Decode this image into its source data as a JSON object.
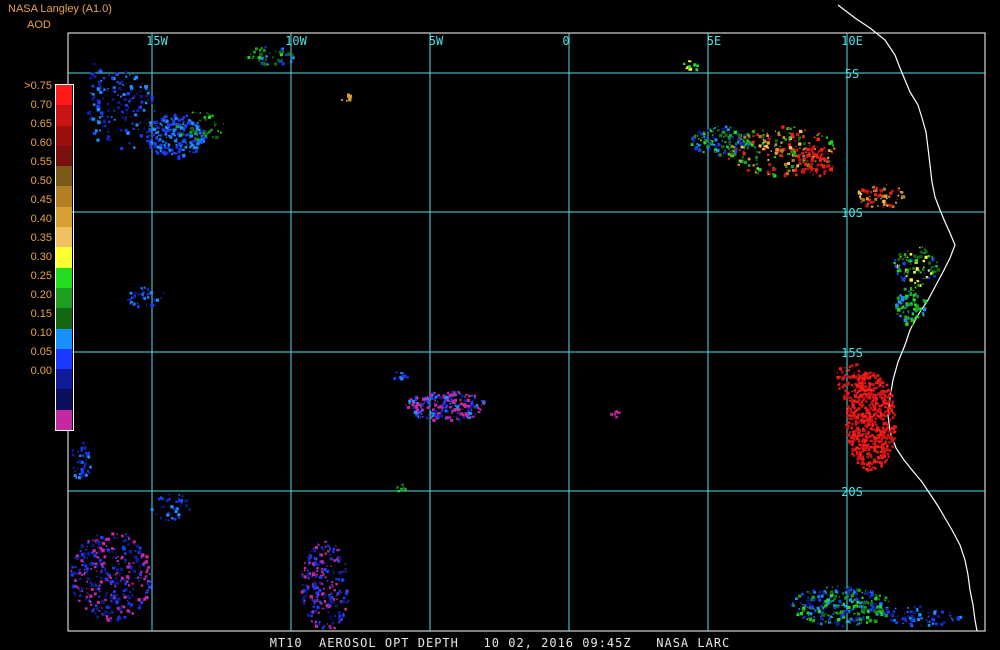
{
  "header": {
    "source": "NASA Langley (A1.0)",
    "parameter": "AOD"
  },
  "legend": {
    "labels": [
      ">0.75",
      "0.70",
      "0.65",
      "0.60",
      "0.55",
      "0.50",
      "0.45",
      "0.40",
      "0.35",
      "0.30",
      "0.25",
      "0.20",
      "0.15",
      "0.10",
      "0.05",
      "0.00"
    ],
    "colors": [
      "#ff1a1a",
      "#c81414",
      "#9b0f0f",
      "#7a1010",
      "#7a5a18",
      "#b57f21",
      "#d8a033",
      "#eec060",
      "#ffff33",
      "#22dd22",
      "#1f9f1f",
      "#126812",
      "#1a90ff",
      "#1a3bff",
      "#0f1c9a",
      "#0a0f5e",
      "#c42aa0"
    ]
  },
  "map": {
    "grid_color": "#4fe0e6",
    "lon_labels": [
      "15W",
      "10W",
      "5W",
      "0",
      "5E",
      "10E"
    ],
    "lat_labels": [
      "5S",
      "10S",
      "15S",
      "20S"
    ]
  },
  "footer": {
    "text": "MT10  AEROSOL OPT DEPTH   10 02, 2016 09:45Z   NASA LARC"
  }
}
